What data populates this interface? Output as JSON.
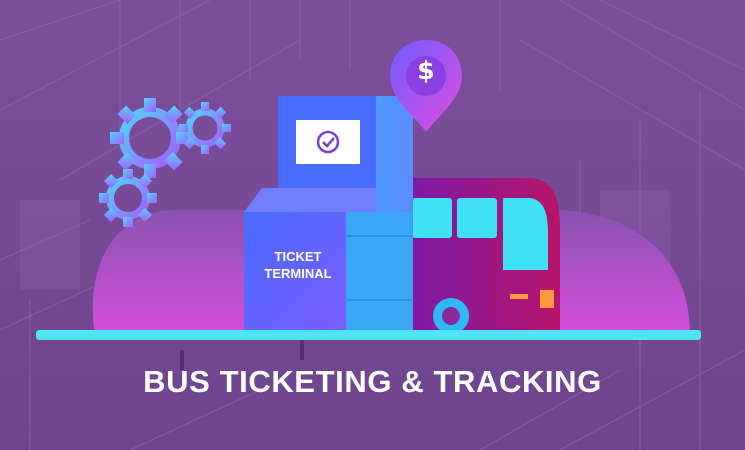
{
  "headline": "BUS TICKETING & TRACKING",
  "terminal": {
    "line1": "TICKET",
    "line2": "TERMINAL"
  },
  "price_pin": {
    "symbol": "$",
    "icon": "price-pin-icon"
  },
  "icons": [
    "gear-icon",
    "checkmark-icon",
    "bus-icon",
    "ticket-terminal-icon",
    "price-pin-icon"
  ],
  "colors": {
    "background": "#7a4b95",
    "platform": "#4fe3f6",
    "terminal": "#5a7bff",
    "bus": "#a0157a",
    "accent_pink": "#e84fd6",
    "pin": "#b34df2",
    "text": "#ffffff"
  }
}
